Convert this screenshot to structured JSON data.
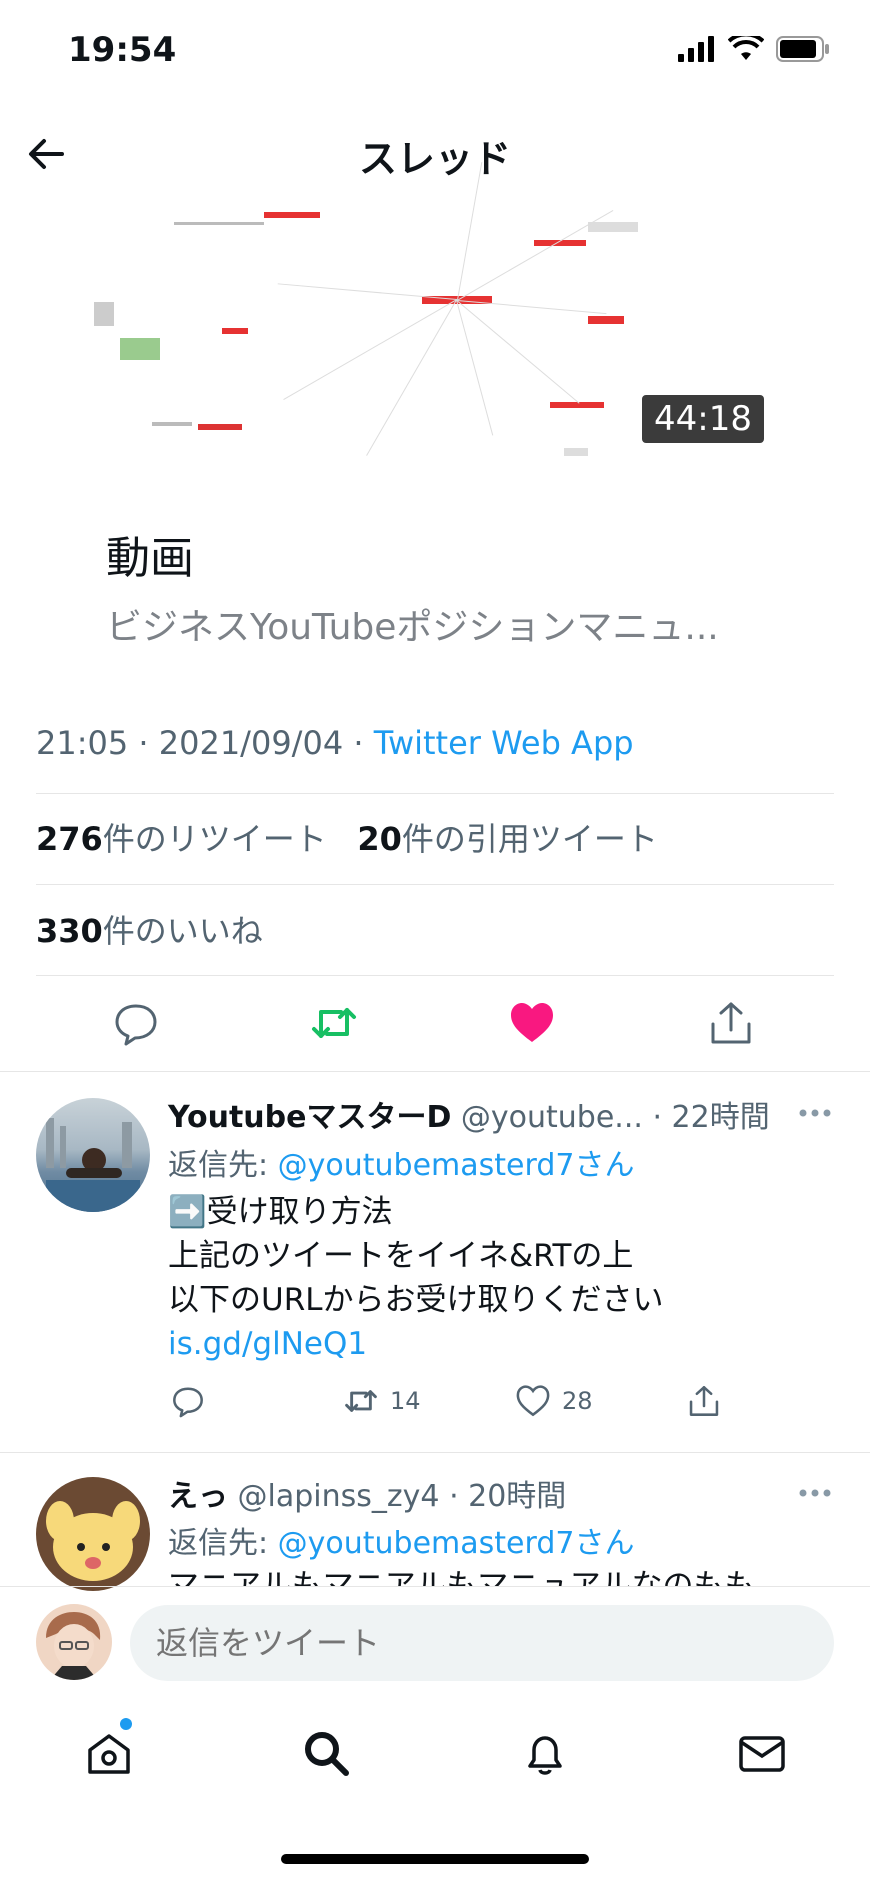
{
  "status_bar": {
    "time": "19:54"
  },
  "header": {
    "title": "スレッド"
  },
  "video": {
    "duration": "44:18",
    "kind": "動画",
    "description": "ビジネスYouTubeポジションマニュ..."
  },
  "tweet_meta": {
    "time": "21:05",
    "date": "2021/09/04",
    "source": "Twitter Web App"
  },
  "stats": {
    "retweets_count": "276",
    "retweets_label": "件のリツイート",
    "quotes_count": "20",
    "quotes_label": "件の引用ツイート",
    "likes_count": "330",
    "likes_label": "件のいいね"
  },
  "colors": {
    "retweet": "#17bf63",
    "like": "#f91880",
    "link": "#1d9bf0"
  },
  "replies": [
    {
      "name": "YoutubeマスターD",
      "handle": "@youtube...",
      "time": "· 22時間",
      "reply_to_prefix": "返信先: ",
      "reply_to": "@youtubemasterd7さん",
      "lines": [
        "➡️受け取り方法",
        "上記のツイートをイイネ&RTの上",
        "以下のURLからお受け取りください"
      ],
      "link": "is.gd/glNeQ1",
      "retweets": "14",
      "likes": "28"
    },
    {
      "name": "えっ",
      "handle": "@lapinss_zy4",
      "time": "· 20時間",
      "reply_to_prefix": "返信先: ",
      "reply_to": "@youtubemasterd7さん",
      "partial_line": "マニアルもマニアルもマニュアルなのもも"
    }
  ],
  "composer": {
    "placeholder": "返信をツイート"
  },
  "tabs": [
    "home-icon",
    "search-icon",
    "bell-icon",
    "mail-icon"
  ]
}
